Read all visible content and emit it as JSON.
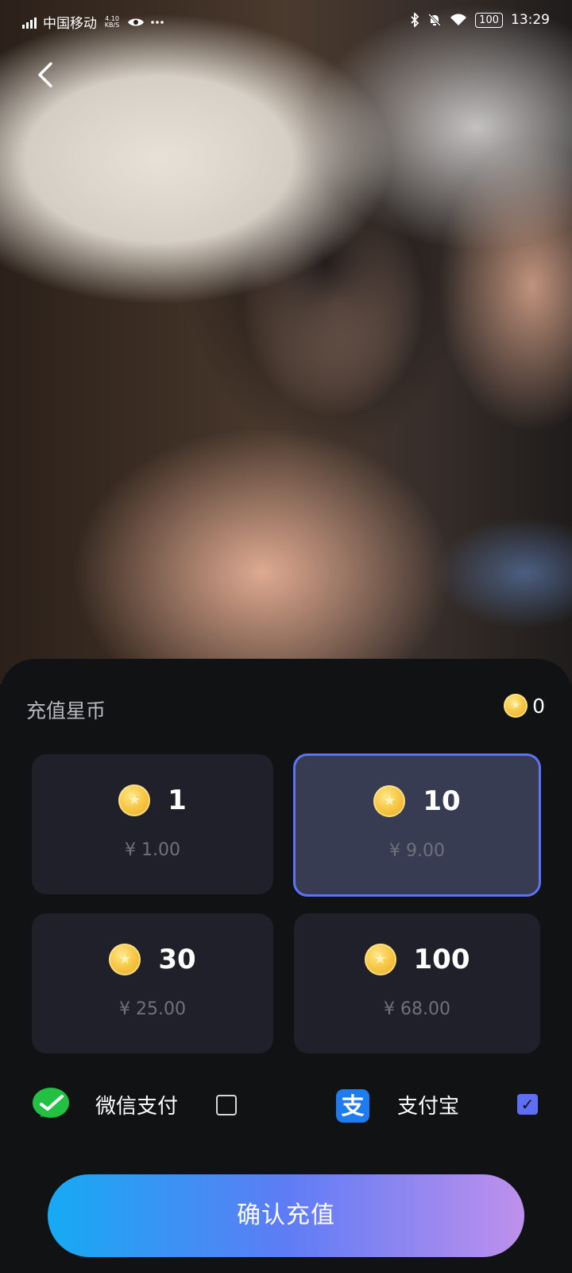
{
  "status_bar": {
    "carrier": "中国移动",
    "net_speed_value": "4.10",
    "net_speed_unit": "KB/S",
    "battery": "100",
    "time": "13:29"
  },
  "header": {
    "back_icon": "chevron-left-icon"
  },
  "sheet": {
    "title": "充值星币",
    "balance": "0",
    "packages": [
      {
        "amount": "1",
        "price": "¥ 1.00",
        "selected": false
      },
      {
        "amount": "10",
        "price": "¥ 9.00",
        "selected": true
      },
      {
        "amount": "30",
        "price": "¥ 25.00",
        "selected": false
      },
      {
        "amount": "100",
        "price": "¥ 68.00",
        "selected": false
      }
    ],
    "payment": {
      "wechat_label": "微信支付",
      "wechat_checked": false,
      "alipay_glyph": "支",
      "alipay_label": "支付宝",
      "alipay_checked": true,
      "check_glyph": "✓"
    },
    "confirm_label": "确认充值"
  },
  "colors": {
    "accent": "#5d73f6",
    "selected_card_bg": "#383c52",
    "card_bg": "#1f2029",
    "button_gradient": [
      "#16aaf3",
      "#5e7cf5",
      "#bf90ec"
    ]
  }
}
